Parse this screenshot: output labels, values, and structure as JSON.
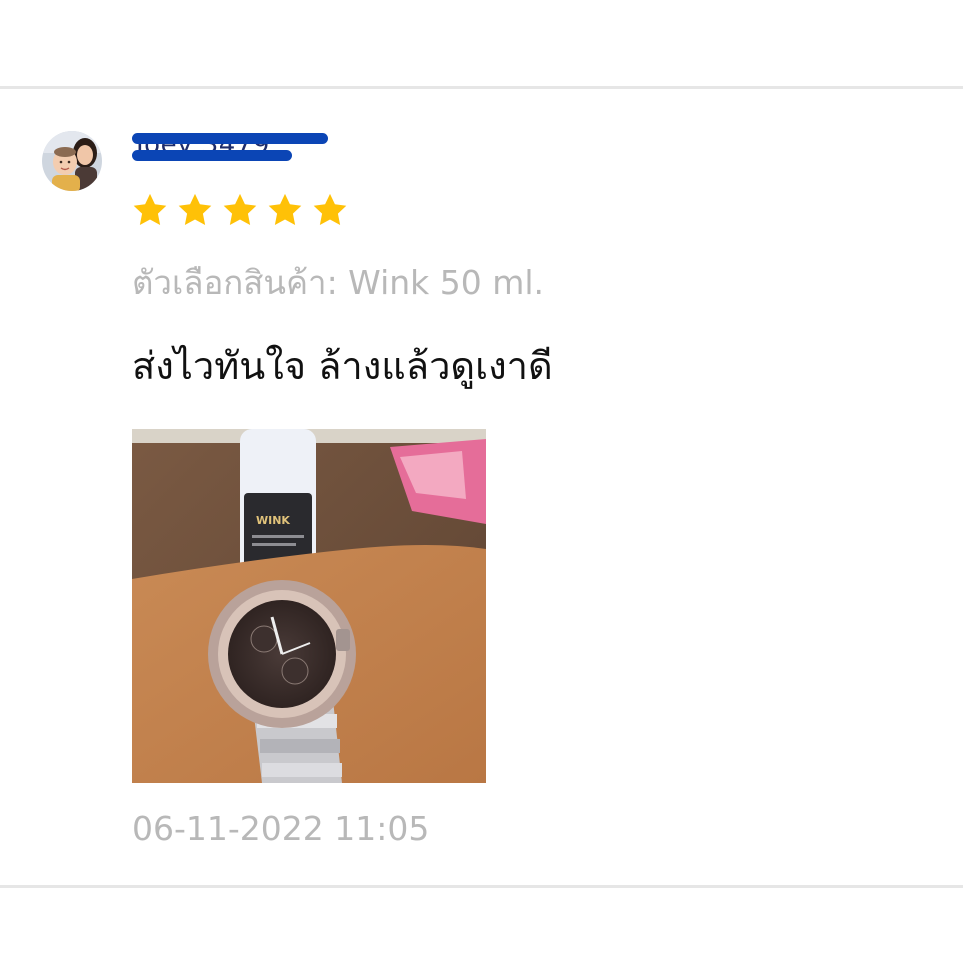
{
  "review": {
    "username": "Ioey 3479",
    "rating": 5,
    "rating_max": 5,
    "variation_label": "ตัวเลือกสินค้า: Wink 50 ml.",
    "comment": "ส่งไวทันใจ ล้างแล้วดูเงาดี",
    "timestamp": "06-11-2022 11:05"
  },
  "colors": {
    "star": "#ffc107",
    "redaction": "#0b45b5",
    "muted_text": "#b8b8b8",
    "divider": "#e6e6e6"
  },
  "icons": {
    "star": "star-icon"
  }
}
